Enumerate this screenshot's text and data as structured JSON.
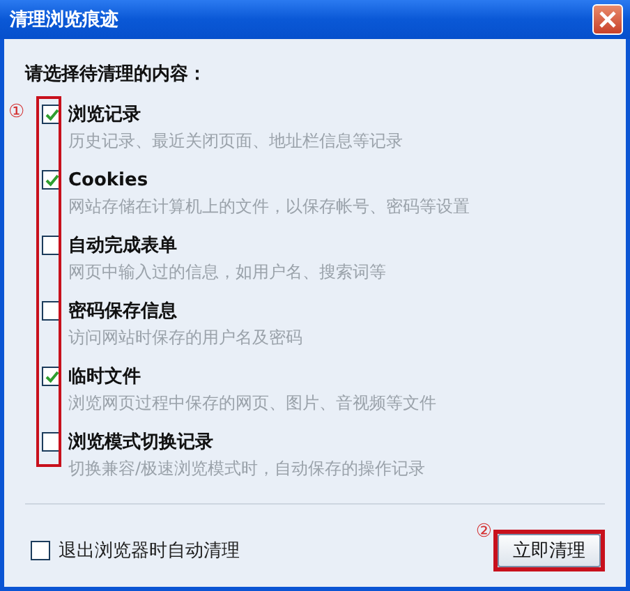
{
  "window": {
    "title": "清理浏览痕迹"
  },
  "heading": "请选择待清理的内容：",
  "items": [
    {
      "title": "浏览记录",
      "description": "历史记录、最近关闭页面、地址栏信息等记录",
      "checked": true
    },
    {
      "title": "Cookies",
      "description": "网站存储在计算机上的文件，以保存帐号、密码等设置",
      "checked": true
    },
    {
      "title": "自动完成表单",
      "description": "网页中输入过的信息，如用户名、搜索词等",
      "checked": false
    },
    {
      "title": "密码保存信息",
      "description": "访问网站时保存的用户名及密码",
      "checked": false
    },
    {
      "title": "临时文件",
      "description": "浏览网页过程中保存的网页、图片、音视频等文件",
      "checked": true
    },
    {
      "title": "浏览模式切换记录",
      "description": "切换兼容/极速浏览模式时，自动保存的操作记录",
      "checked": false
    }
  ],
  "auto_clean": {
    "label": "退出浏览器时自动清理",
    "checked": false
  },
  "clean_button": {
    "label": "立即清理"
  },
  "annotations": [
    {
      "label": "①"
    },
    {
      "label": "②"
    }
  ]
}
